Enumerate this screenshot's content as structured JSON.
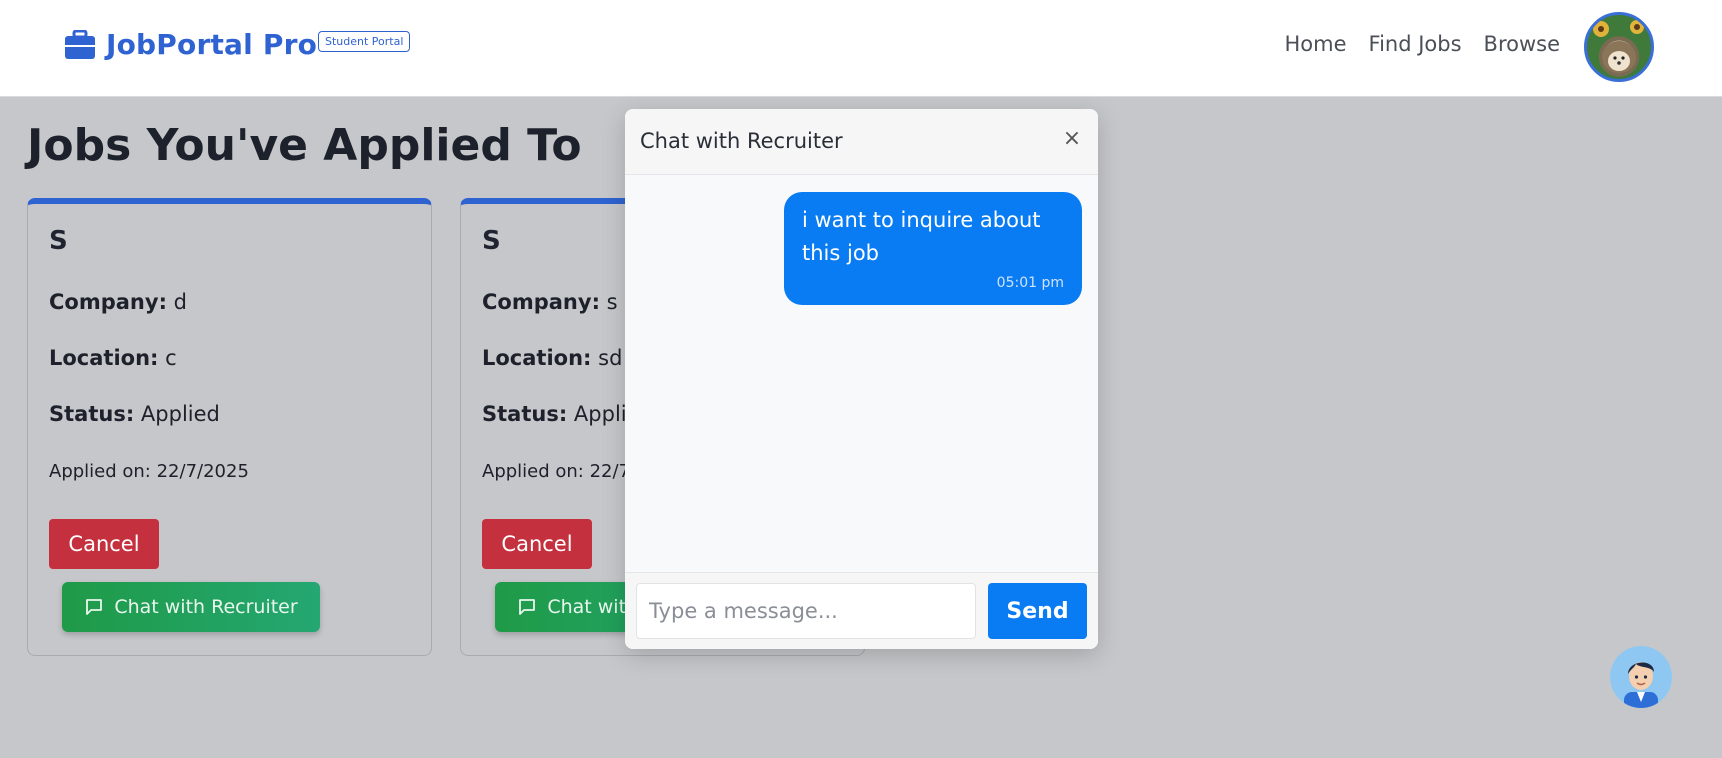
{
  "navbar": {
    "brand_name": "JobPortal Pro",
    "brand_badge": "Student Portal",
    "brand_icon": "briefcase-icon",
    "links": [
      "Home",
      "Find Jobs",
      "Browse"
    ],
    "brand_color": "#2f63d1"
  },
  "page": {
    "title": "Jobs You've Applied To"
  },
  "jobs": [
    {
      "title": "S",
      "company_label": "Company:",
      "company": "d",
      "location_label": "Location:",
      "location": "c",
      "status_label": "Status:",
      "status": "Applied",
      "applied_on": "Applied on: 22/7/2025",
      "cancel_label": "Cancel",
      "chat_label": "Chat with Recruiter"
    },
    {
      "title": "S",
      "company_label": "Company:",
      "company": "s",
      "location_label": "Location:",
      "location": "sd",
      "status_label": "Status:",
      "status": "Applied",
      "applied_on": "Applied on: 22/7/2025",
      "cancel_label": "Cancel",
      "chat_label": "Chat with Recruiter"
    }
  ],
  "chat": {
    "title": "Chat with Recruiter",
    "close_icon": "close-icon",
    "messages": [
      {
        "text": "i want to inquire about this job",
        "time": "05:01 pm"
      }
    ],
    "input_placeholder": "Type a message...",
    "send_label": "Send",
    "accent_color": "#0a7cf3"
  },
  "colors": {
    "cancel": "#c4303e",
    "chat_button": "#1f9a47"
  }
}
